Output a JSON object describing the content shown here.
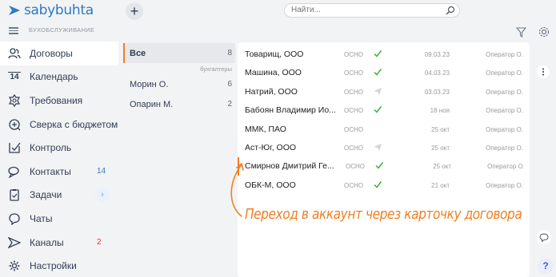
{
  "app": {
    "logo": "sabybuhta",
    "company": "БУХОБСЛУЖИВАНИЕ"
  },
  "sidebar": {
    "items": [
      {
        "label": "Договоры",
        "icon": "people-icon",
        "active": true
      },
      {
        "label": "Календарь",
        "icon": "calendar-icon",
        "day": "14"
      },
      {
        "label": "Требования",
        "icon": "emblem-icon"
      },
      {
        "label": "Сверка с бюджетом",
        "icon": "reconcile-icon"
      },
      {
        "label": "Контроль",
        "icon": "control-icon"
      },
      {
        "label": "Контакты",
        "icon": "chat-bubbles-icon",
        "count": "14"
      },
      {
        "label": "Задачи",
        "icon": "tasks-icon",
        "chevron": "›"
      },
      {
        "label": "Чаты",
        "icon": "chats-icon"
      },
      {
        "label": "Каналы",
        "icon": "channels-icon",
        "count": "2"
      },
      {
        "label": "Настройки",
        "icon": "settings-icon"
      }
    ]
  },
  "topbar": {
    "add_label": "+",
    "search_placeholder": "Найти..."
  },
  "filters": {
    "all_label": "Все",
    "all_count": "8",
    "caption": "бухгалтеры",
    "people": [
      {
        "name": "Морин О.",
        "count": "6"
      },
      {
        "name": "Опарин М.",
        "count": "2"
      }
    ]
  },
  "contracts": [
    {
      "name": "Товарищ, ООО",
      "tax": "ОСНО",
      "status": "check",
      "date": "09.03.23",
      "operator": "Оператор О."
    },
    {
      "name": "Машина, ООО",
      "tax": "ОСНО",
      "status": "check",
      "date": "04.03.23",
      "operator": "Оператор О."
    },
    {
      "name": "Натрий, ООО",
      "tax": "ОСНО",
      "status": "plane",
      "date": "03.03.23",
      "operator": "Оператор О."
    },
    {
      "name": "Бабоян Владимир Ио...",
      "tax": "ОСНО",
      "status": "check",
      "date": "18 ноя",
      "operator": "Оператор О."
    },
    {
      "name": "ММК, ПАО",
      "tax": "ОСНО",
      "status": "none",
      "date": "25 окт",
      "operator": "Оператор О."
    },
    {
      "name": "Аст-Юг, ООО",
      "tax": "ОСНО",
      "status": "plane",
      "date": "25 окт",
      "operator": "Оператор О."
    },
    {
      "name": "Смирнов Дмитрий Ге...",
      "tax": "ОСНО",
      "status": "check",
      "date": "25 окт",
      "operator": "Оператор О."
    },
    {
      "name": "ОБК-М, ООО",
      "tax": "ОСНО",
      "status": "check",
      "date": "21 окт",
      "operator": "Оператор О."
    }
  ],
  "annotation": "Переход в аккаунт через карточку договора",
  "help_label": "?",
  "colors": {
    "accent": "#f07f21",
    "brand": "#2b7bc4",
    "check": "#3fae3f"
  }
}
